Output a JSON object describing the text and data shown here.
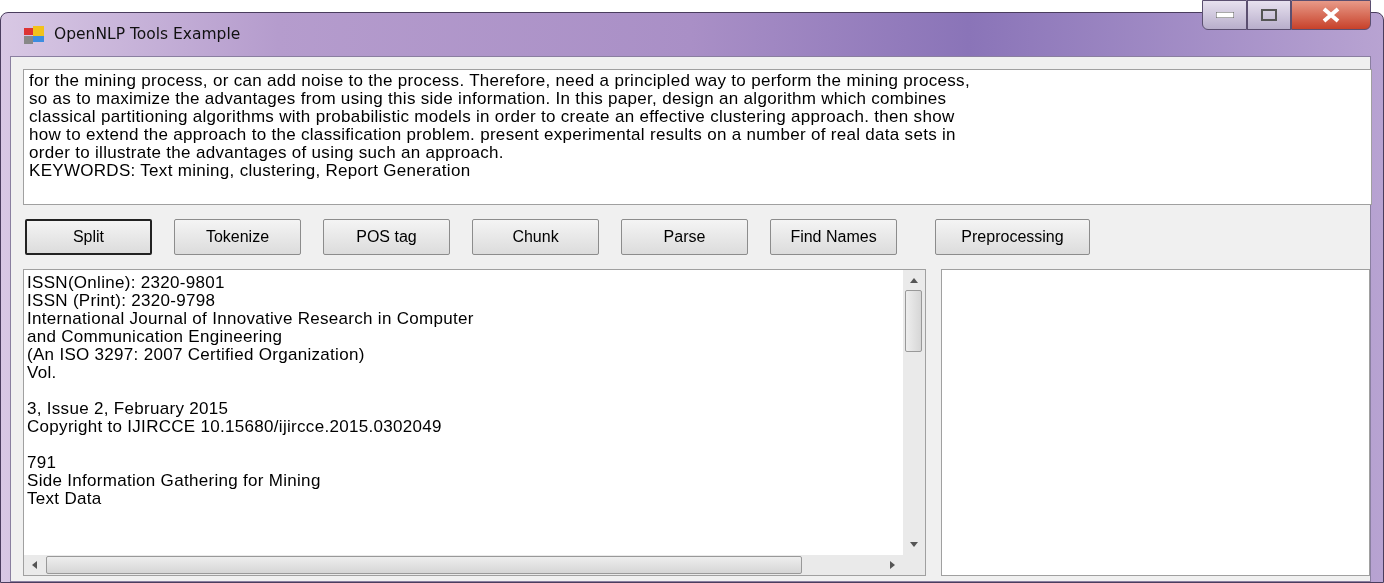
{
  "window": {
    "title": "OpenNLP Tools Example"
  },
  "input_text": {
    "lines": [
      "for the mining process, or can add noise to the process. Therefore, need a principled way to perform the mining process,",
      "so as to maximize the advantages from using this side information. In this paper, design an algorithm which combines",
      "classical partitioning algorithms with probabilistic models in order to create an effective clustering approach. then show",
      "how to extend the approach to the classification problem. present experimental results on a number of real data sets in",
      "order to illustrate the advantages of using such an approach.",
      "KEYWORDS: Text mining, clustering, Report Generation"
    ]
  },
  "buttons": [
    {
      "label": "Split",
      "focused": true
    },
    {
      "label": "Tokenize",
      "focused": false
    },
    {
      "label": "POS tag",
      "focused": false
    },
    {
      "label": "Chunk",
      "focused": false
    },
    {
      "label": "Parse",
      "focused": false
    },
    {
      "label": "Find Names",
      "focused": false
    },
    {
      "label": "Preprocessing",
      "focused": false
    }
  ],
  "output_text": {
    "paragraphs": [
      [
        "ISSN(Online): 2320-9801",
        "ISSN (Print): 2320-9798",
        "International Journal of Innovative Research in Computer",
        "and Communication Engineering",
        "(An ISO 3297: 2007 Certified Organization)",
        "Vol."
      ],
      [
        "3, Issue 2, February 2015",
        "Copyright to IJIRCCE 10.15680/ijircce.2015.0302049"
      ],
      [
        "791",
        "Side Information Gathering for Mining",
        "Text Data"
      ]
    ]
  }
}
